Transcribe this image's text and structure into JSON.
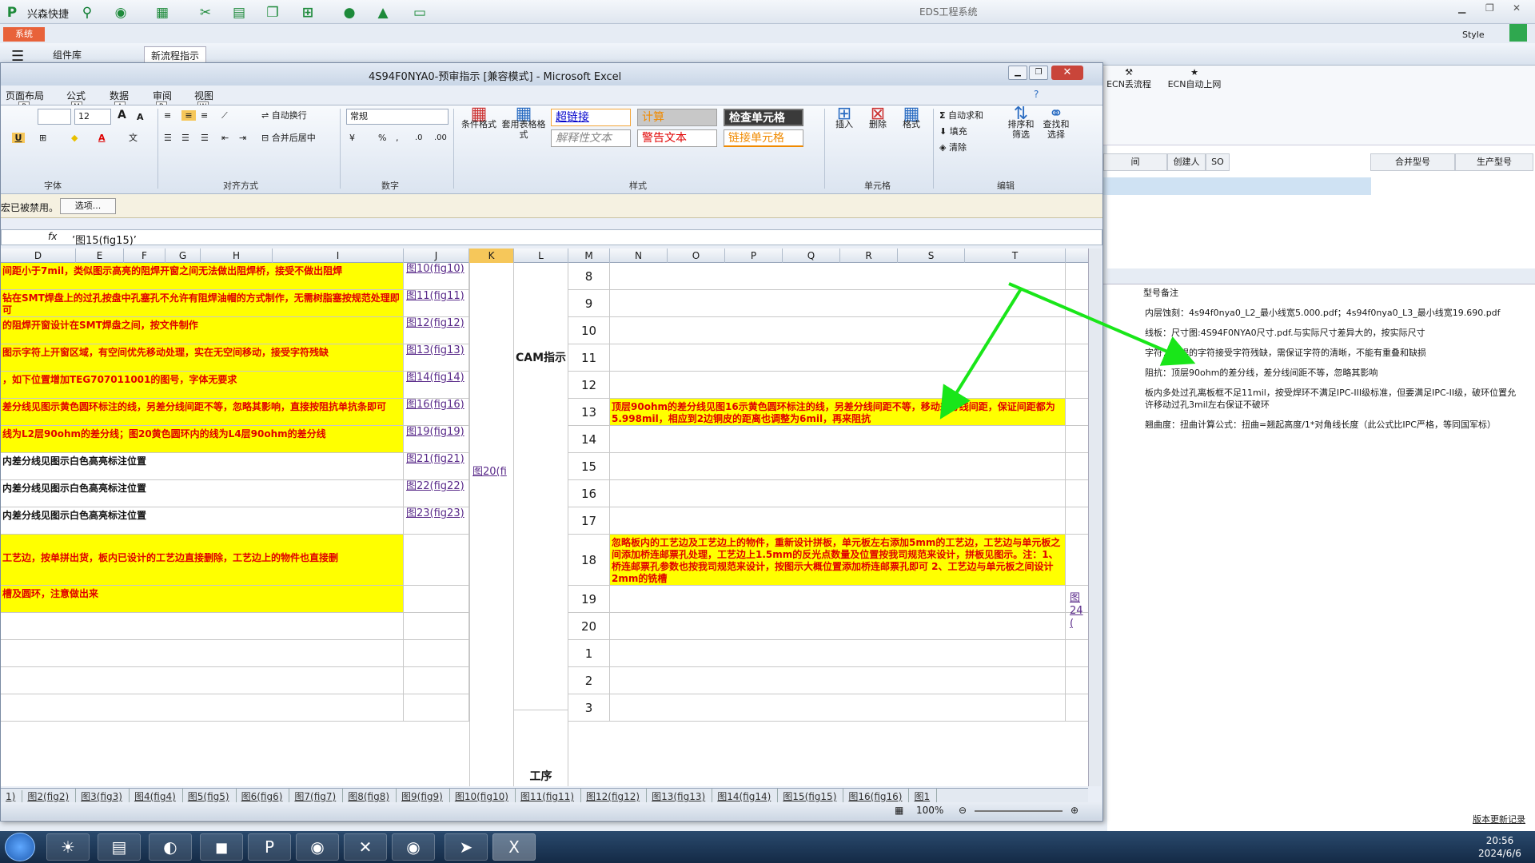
{
  "app": {
    "brand": "兴森快捷",
    "title": "EDS工程系统",
    "sys_tab": "系统",
    "style": "Style",
    "tabs": [
      "组件库",
      "新流程指示"
    ]
  },
  "behind": {
    "buttons": [
      "ECN丢流程",
      "ECN自动上网"
    ],
    "headers": [
      "间",
      "创建人",
      "SO",
      "合并型号",
      "生产型号"
    ],
    "panel_title": "型号备注",
    "notes": [
      "内层蚀刻：4s94f0nya0_L2_最小线宽5.000.pdf；4s94f0nya0_L3_最小线宽19.690.pdf",
      "线板：尺寸图:4S94F0NYA0尺寸.pdf.与实际尺寸差异大的，按实际尺寸",
      "字符：阻焊的字符接受字符残缺，需保证字符的清晰，不能有重叠和缺损",
      "阻抗：顶层90ohm的差分线，差分线间距不等，忽略其影响",
      "板内多处过孔离板框不足11mil，按受焊环不满足IPC-III级标准，但要满足IPC-II级，破环位置允许移动过孔3mil左右保证不破环",
      "翘曲度：扭曲计算公式：扭曲=翘起高度/1*对角线长度（此公式比IPC严格，等同国军标）"
    ],
    "version": "版本更新记录"
  },
  "excel": {
    "title": "4S94F0NYA0-预审指示 [兼容模式] - Microsoft Excel",
    "ribbon_tabs": [
      {
        "label": "页面布局",
        "key": "P"
      },
      {
        "label": "公式",
        "key": "M"
      },
      {
        "label": "数据",
        "key": "A"
      },
      {
        "label": "审阅",
        "key": "R"
      },
      {
        "label": "视图",
        "key": "W"
      }
    ],
    "font_size": "12",
    "number_format": "常规",
    "groups": {
      "font": "字体",
      "align": "对齐方式",
      "number": "数字",
      "styles": "样式",
      "cells": "单元格",
      "edit": "编辑"
    },
    "buttons": {
      "wrap": "自动换行",
      "merge": "合并后居中",
      "cond": "条件格式",
      "table_fmt": "套用表格格式",
      "insert": "插入",
      "delete": "删除",
      "format": "格式",
      "autosum": "自动求和",
      "fill": "填充",
      "clear": "清除",
      "sort": "排序和筛选",
      "find": "查找和选择"
    },
    "styles": {
      "hyperlink": "超链接",
      "calc": "计算",
      "check": "检查单元格",
      "explain": "解释性文本",
      "warn": "警告文本",
      "linked": "链接单元格"
    },
    "msg": "宏已被禁用。",
    "options": "选项...",
    "formula": "’图15(fig15)’",
    "columns": [
      "D",
      "E",
      "F",
      "G",
      "H",
      "I",
      "J",
      "K",
      "L",
      "M",
      "N",
      "O",
      "P",
      "Q",
      "R",
      "S",
      "T"
    ],
    "rows": [
      {
        "text": "间距小于7mil，类似图示高亮的阻焊开窗之间无法做出阻焊桥，接受不做出阻焊",
        "link": "图10(fig10)",
        "num": "8",
        "n": ""
      },
      {
        "text": "钻在SMT焊盘上的过孔按盘中孔塞孔不允许有阻焊油帽的方式制作，无需树脂塞按规范处理即可",
        "link": "图11(fig11)",
        "num": "9",
        "n": ""
      },
      {
        "text": "的阻焊开窗设计在SMT焊盘之间，按文件制作",
        "link": "图12(fig12)",
        "num": "10",
        "n": ""
      },
      {
        "text": "图示字符上开窗区域，有空间优先移动处理，实在无空间移动，接受字符残缺",
        "link": "图13(fig13)",
        "num": "11",
        "n": ""
      },
      {
        "text": "，如下位置增加TEG707011001的图号，字体无要求",
        "link": "图14(fig14)",
        "num": "12",
        "n": ""
      },
      {
        "text": "差分线见图示黄色圆环标注的线，另差分线间距不等，忽略其影响，直接按阻抗单抗条即可",
        "link": "图16(fig16)",
        "num": "13",
        "n": "顶层90ohm的差分线见图16示黄色圆环标注的线，另差分线间距不等，移动差分线间距，保证间距都为5.998mil，相应到2边铜皮的距离也调整为6mil，再来阻抗"
      },
      {
        "text": "线为L2层90ohm的差分线；图20黄色圆环内的线为L4层90ohm的差分线",
        "link": "图19(fig19)",
        "num": "14",
        "n": ""
      },
      {
        "text": "内差分线见图示白色高亮标注位置",
        "link": "图21(fig21)",
        "num": "15",
        "n": ""
      },
      {
        "text": "内差分线见图示白色高亮标注位置",
        "link": "图22(fig22)",
        "num": "16",
        "n": ""
      },
      {
        "text": "内差分线见图示白色高亮标注位置",
        "link": "图23(fig23)",
        "num": "17",
        "n": ""
      },
      {
        "text": "工艺边，按单拼出货，板内已设计的工艺边直接删除，工艺边上的物件也直接删",
        "link": "",
        "num": "18",
        "n": "忽略板内的工艺边及工艺边上的物件，重新设计拼板，单元板左右添加5mm的工艺边，工艺边与单元板之间添加桥连邮票孔处理，工艺边上1.5mm的反光点数量及位置按我司规范来设计，拼板见图示。注：1、桥连邮票孔参数也按我司规范来设计，按图示大概位置添加桥连邮票孔即可   2、工艺边与单元板之间设计2mm的铣槽"
      },
      {
        "text": "槽及圆环，注意做出来",
        "link": "",
        "num": "19",
        "n": ""
      },
      {
        "text": "",
        "link": "",
        "num": "20",
        "n": ""
      },
      {
        "text": "",
        "link": "",
        "num": "1",
        "n": ""
      },
      {
        "text": "",
        "link": "",
        "num": "2",
        "n": ""
      },
      {
        "text": "",
        "link": "",
        "num": "3",
        "n": ""
      }
    ],
    "k_link": "图20(fi",
    "t_link": "图24(",
    "cam": "CAM指示",
    "process": "工序",
    "sheets": [
      "1)",
      "图2(fig2)",
      "图3(fig3)",
      "图4(fig4)",
      "图5(fig5)",
      "图6(fig6)",
      "图7(fig7)",
      "图8(fig8)",
      "图9(fig9)",
      "图10(fig10)",
      "图11(fig11)",
      "图12(fig12)",
      "图13(fig13)",
      "图14(fig14)",
      "图15(fig15)",
      "图16(fig16)",
      "图1"
    ],
    "zoom": "100%"
  },
  "clock": {
    "time": "20:56",
    "date": "2024/6/6"
  }
}
